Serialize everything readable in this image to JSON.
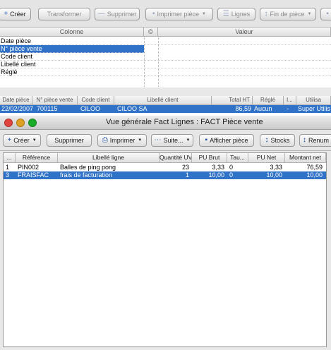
{
  "back_toolbar": {
    "create": "Créer",
    "transform": "Transformer",
    "delete": "Supprimer",
    "print": "Imprimer pièce",
    "lines": "Lignes",
    "end": "Fin de pièce"
  },
  "props": {
    "col_column": "Colonne",
    "col_copy": "©",
    "col_value": "Valeur",
    "rows": [
      "Date pièce",
      "N° pièce vente",
      "Code client",
      "Libellé client",
      "Réglé"
    ]
  },
  "back_list": {
    "headers": [
      "Date pièce",
      "N° pièce vente",
      "Code client",
      "Libellé client",
      "Total HT",
      "Réglé",
      "l...",
      "Utilisa"
    ],
    "row": {
      "date": "22/02/2007",
      "number": "700115",
      "code": "CILOO",
      "label": "CILOO SA",
      "total": "86,59",
      "paid": "Aucun",
      "flag": "-",
      "user": "Super Utilis"
    }
  },
  "front_window": {
    "title": "Vue générale Fact Lignes : FACT Pièce vente",
    "toolbar": {
      "create": "Créer",
      "delete": "Supprimer",
      "print": "Imprimer",
      "more": "Suite...",
      "show": "Afficher pièce",
      "stocks": "Stocks",
      "renum": "Renum"
    },
    "headers": [
      "...",
      "Référence",
      "Libellé ligne",
      "Quantité UV",
      "PU Brut",
      "Tau...",
      "PU Net",
      "Montant net"
    ],
    "rows": [
      {
        "n": "1",
        "ref": "PIN002",
        "label": "Balles de ping pong",
        "qty": "23",
        "brut": "3,33",
        "tau": "0",
        "net": "3,33",
        "amount": "76,59"
      },
      {
        "n": "3",
        "ref": "FRAISFAC",
        "label": "frais de facturation",
        "qty": "1",
        "brut": "10,00",
        "tau": "0",
        "net": "10,00",
        "amount": "10,00"
      }
    ]
  },
  "colors": {
    "selection": "#2f72c8",
    "close": "#e0443e",
    "minimize": "#dea123",
    "zoom": "#1aab29"
  }
}
